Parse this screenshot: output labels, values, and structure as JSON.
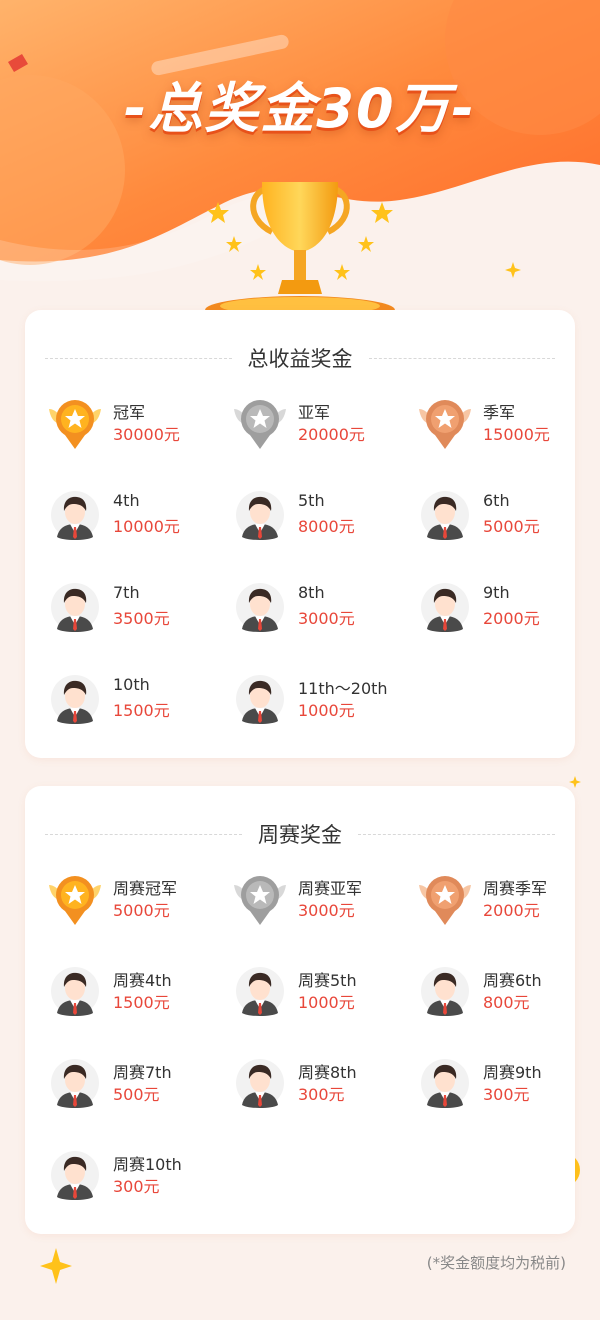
{
  "header": {
    "title": "-总奖金30万-"
  },
  "total_section": {
    "title": "总收益奖金",
    "items": [
      {
        "name": "冠军",
        "amount": "30000元",
        "icon": "gold-medal-icon"
      },
      {
        "name": "亚军",
        "amount": "20000元",
        "icon": "silver-medal-icon"
      },
      {
        "name": "季军",
        "amount": "15000元",
        "icon": "bronze-medal-icon"
      },
      {
        "name": "4th",
        "amount": "10000元",
        "icon": "avatar-icon"
      },
      {
        "name": "5th",
        "amount": "8000元",
        "icon": "avatar-icon"
      },
      {
        "name": "6th",
        "amount": "5000元",
        "icon": "avatar-icon"
      },
      {
        "name": "7th",
        "amount": "3500元",
        "icon": "avatar-icon"
      },
      {
        "name": "8th",
        "amount": "3000元",
        "icon": "avatar-icon"
      },
      {
        "name": "9th",
        "amount": "2000元",
        "icon": "avatar-icon"
      },
      {
        "name": "10th",
        "amount": "1500元",
        "icon": "avatar-icon"
      },
      {
        "name": "11th～20th",
        "amount": "1000元",
        "icon": "avatar-icon"
      }
    ]
  },
  "weekly_section": {
    "title": "周赛奖金",
    "items": [
      {
        "name": "周赛冠军",
        "amount": "5000元",
        "icon": "gold-medal-icon"
      },
      {
        "name": "周赛亚军",
        "amount": "3000元",
        "icon": "silver-medal-icon"
      },
      {
        "name": "周赛季军",
        "amount": "2000元",
        "icon": "bronze-medal-icon"
      },
      {
        "name": "周赛4th",
        "amount": "1500元",
        "icon": "avatar-icon"
      },
      {
        "name": "周赛5th",
        "amount": "1000元",
        "icon": "avatar-icon"
      },
      {
        "name": "周赛6th",
        "amount": "800元",
        "icon": "avatar-icon"
      },
      {
        "name": "周赛7th",
        "amount": "500元",
        "icon": "avatar-icon"
      },
      {
        "name": "周赛8th",
        "amount": "300元",
        "icon": "avatar-icon"
      },
      {
        "name": "周赛9th",
        "amount": "300元",
        "icon": "avatar-icon"
      },
      {
        "name": "周赛10th",
        "amount": "300元",
        "icon": "avatar-icon"
      }
    ]
  },
  "footnote": "(*奖金额度均为税前)",
  "colors": {
    "accent": "#ff7a2e",
    "amount": "#e8473a",
    "page_bg": "#fbf1ec"
  }
}
